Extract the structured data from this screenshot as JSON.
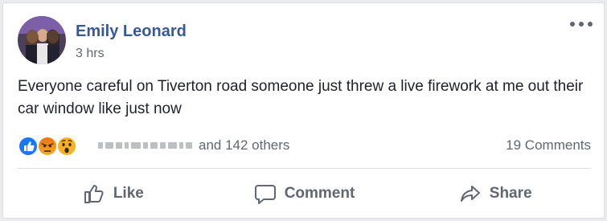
{
  "post": {
    "author": "Emily Leonard",
    "timestamp": "3 hrs",
    "text": "Everyone careful on Tiverton road someone just threw a live firework at me out their car window like just now"
  },
  "reactions": {
    "types": [
      "like",
      "angry",
      "wow"
    ],
    "others_text": "and 142 others"
  },
  "comments_count": "19 Comments",
  "actions": {
    "like": "Like",
    "comment": "Comment",
    "share": "Share"
  },
  "colors": {
    "author": "#385898",
    "like_blue": "#1877f2",
    "reaction_yellow": "#f7b125",
    "angry_orange": "#e9710f",
    "muted_text": "#606770"
  },
  "icons": [
    "more-options-icon",
    "like-reaction-icon",
    "angry-reaction-icon",
    "wow-reaction-icon",
    "thumbs-up-icon",
    "comment-icon",
    "share-icon"
  ]
}
